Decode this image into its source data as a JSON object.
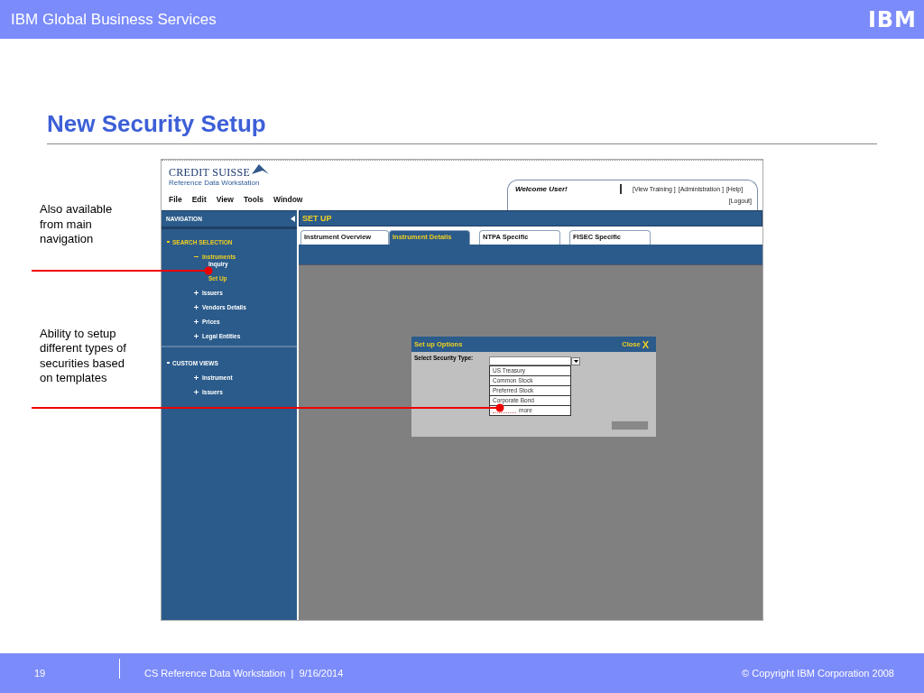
{
  "header": {
    "title": "IBM Global Business Services",
    "logo": "IBM"
  },
  "slide_title": "New Security Setup",
  "annotations": [
    "Also available from main navigation",
    "Ability to setup different types of securities based on templates"
  ],
  "app": {
    "logo": "CREDIT SUISSE",
    "subtitle": "Reference Data Workstation",
    "menu": [
      "File",
      "Edit",
      "View",
      "Tools",
      "Window"
    ],
    "welcome": "Welcome User!",
    "links": [
      "[View Training ]",
      "[Administration ]",
      "[Help]",
      "[Logout]"
    ],
    "navigation": {
      "title": "NAVIGATION",
      "sections": [
        {
          "label": "SEARCH SELECTION",
          "selected": true,
          "children": [
            {
              "label": "Instruments",
              "selected": true,
              "expanded": true,
              "children": [
                {
                  "label": "Inquiry",
                  "selected": false
                },
                {
                  "label": "Set Up",
                  "selected": true
                }
              ]
            },
            {
              "label": "Issuers",
              "selected": false,
              "expanded": false
            },
            {
              "label": "Vendors Details",
              "selected": false,
              "expanded": false
            },
            {
              "label": "Prices",
              "selected": false,
              "expanded": false
            },
            {
              "label": "Legal Entities",
              "selected": false,
              "expanded": false
            }
          ]
        },
        {
          "label": "CUSTOM VIEWS",
          "selected": false,
          "children": [
            {
              "label": "Instrument",
              "selected": false,
              "expanded": false
            },
            {
              "label": "Issuers",
              "selected": false,
              "expanded": false
            }
          ]
        }
      ]
    },
    "page_title": "SET UP",
    "tabs": [
      {
        "label": "Instrument Overview",
        "selected": false
      },
      {
        "label": "Instrument Details",
        "selected": true
      },
      {
        "label": "NTPA Specific",
        "selected": false
      },
      {
        "label": "FISEC Specific",
        "selected": false
      }
    ],
    "dialog": {
      "title": "Set up Options",
      "close": "Close",
      "close_mark": "X",
      "field_label": "Select Security Type:",
      "options": [
        {
          "label": "US Treasury",
          "kind": "option"
        },
        {
          "label": "Common Stock",
          "kind": "option"
        },
        {
          "label": "Preferred Stock",
          "kind": "option"
        },
        {
          "label": "Corporate Bond",
          "kind": "option"
        },
        {
          "label": "more",
          "kind": "more"
        }
      ]
    }
  },
  "footer": {
    "page": "19",
    "text": "CS Reference Data Workstation  |  9/16/2014",
    "copyright": "© Copyright IBM Corporation 2008"
  }
}
